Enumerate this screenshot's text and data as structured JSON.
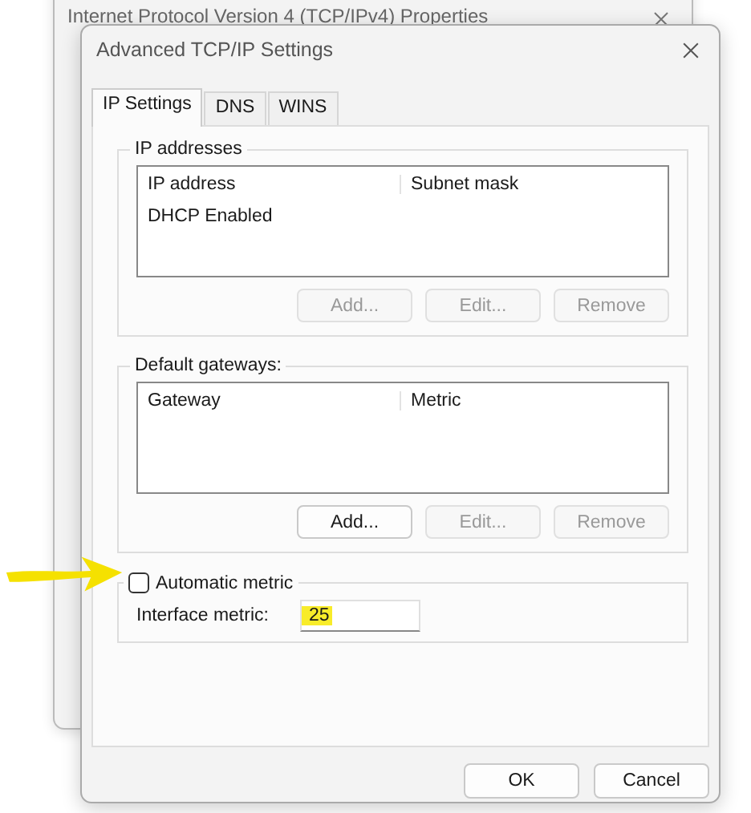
{
  "back_window": {
    "title": "Internet Protocol Version 4 (TCP/IPv4) Properties"
  },
  "dialog": {
    "title": "Advanced TCP/IP Settings"
  },
  "tabs": [
    {
      "label": "IP Settings",
      "selected": true
    },
    {
      "label": "DNS",
      "selected": false
    },
    {
      "label": "WINS",
      "selected": false
    }
  ],
  "ip_addresses": {
    "label": "IP addresses",
    "columns": [
      "IP address",
      "Subnet mask"
    ],
    "rows": [
      [
        "DHCP Enabled"
      ]
    ],
    "buttons": [
      {
        "label": "Add...",
        "disabled": true
      },
      {
        "label": "Edit...",
        "disabled": true
      },
      {
        "label": "Remove",
        "disabled": true
      }
    ]
  },
  "default_gateways": {
    "label": "Default gateways:",
    "columns": [
      "Gateway",
      "Metric"
    ],
    "buttons": [
      {
        "label": "Add...",
        "disabled": false
      },
      {
        "label": "Edit...",
        "disabled": true
      },
      {
        "label": "Remove",
        "disabled": true
      }
    ]
  },
  "automatic_metric": {
    "label": "Automatic metric",
    "checked": false
  },
  "interface_metric": {
    "label": "Interface metric:",
    "value": "25",
    "highlighted": true
  },
  "buttons": [
    {
      "label": "OK"
    },
    {
      "label": "Cancel"
    }
  ]
}
